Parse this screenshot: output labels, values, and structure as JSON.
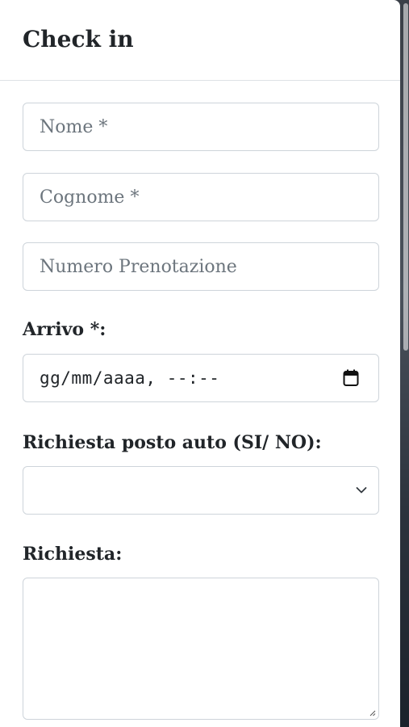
{
  "modal": {
    "title": "Check in"
  },
  "form": {
    "nome_placeholder": "Nome *",
    "cognome_placeholder": "Cognome *",
    "numero_placeholder": "Numero Prenotazione",
    "arrivo_label": "Arrivo *:",
    "arrivo_value": "gg/mm/aaaa, --:--",
    "parking_label": "Richiesta posto auto (SI/ NO):",
    "parking_selected": "",
    "richiesta_label": "Richiesta:",
    "richiesta_value": ""
  },
  "icons": {
    "date_picker": "calendar-icon",
    "select_arrow": "chevron-down-icon",
    "textarea_resize": "resize-grip-icon"
  },
  "colors": {
    "text": "#212529",
    "placeholder": "#6c757d",
    "border": "#ced4da"
  }
}
